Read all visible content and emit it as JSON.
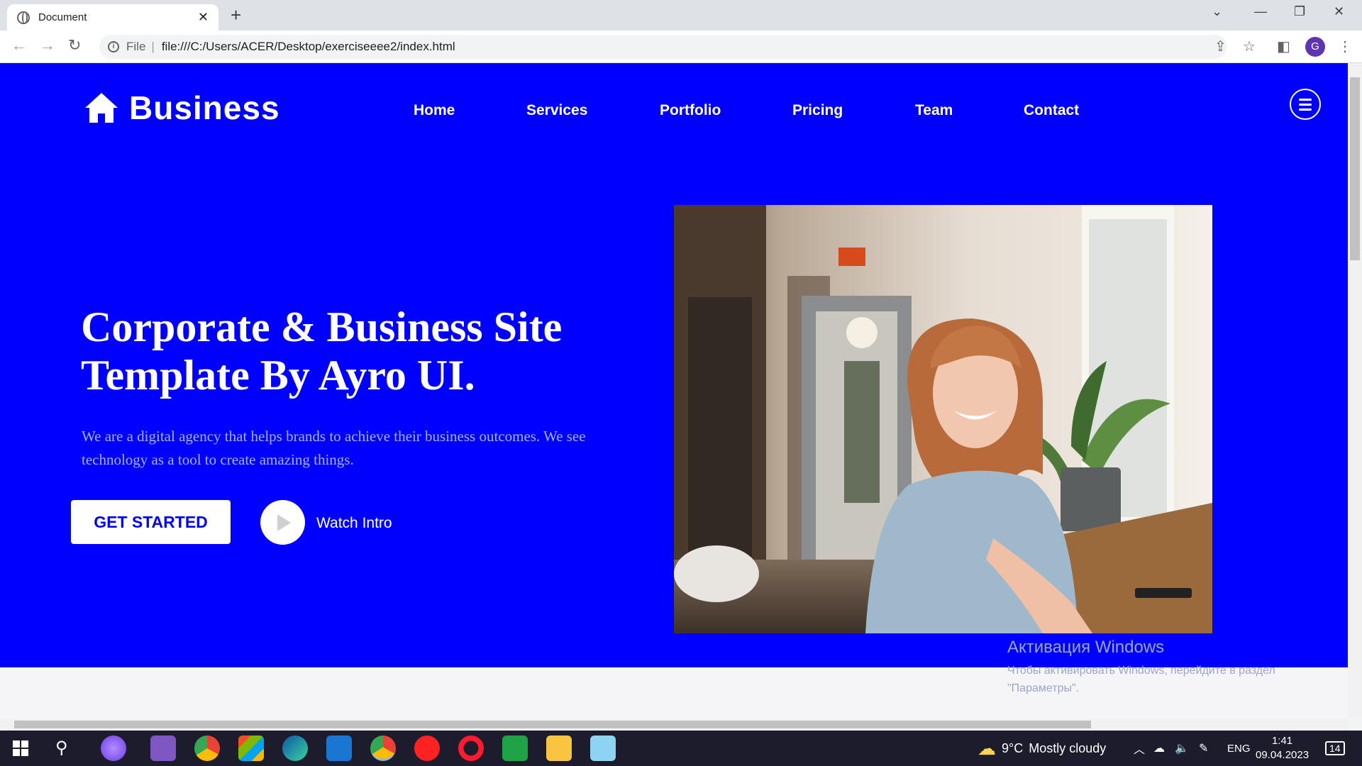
{
  "browser": {
    "tab_title": "Document",
    "tab_close": "✕",
    "new_tab": "+",
    "address_scheme": "File",
    "address_url": "file:///C:/Users/ACER/Desktop/exerciseeee2/index.html",
    "profile_initial": "G"
  },
  "site": {
    "brand": "Business",
    "nav": [
      "Home",
      "Services",
      "Portfolio",
      "Pricing",
      "Team",
      "Contact"
    ],
    "headline": "Corporate & Business Site Template By Ayro UI.",
    "subtext": "We are a digital agency that helps brands to achieve their business outcomes. We see technology as a tool to create amazing things.",
    "cta_primary": "GET STARTED",
    "cta_secondary": "Watch Intro",
    "hero_color": "#0000ff"
  },
  "watermark": {
    "title": "Активация Windows",
    "line1": "Чтобы активировать Windows, перейдите в раздел",
    "line2": "\"Параметры\"."
  },
  "taskbar": {
    "weather_temp": "9°C",
    "weather_desc": "Mostly cloudy",
    "language": "ENG",
    "time": "1:41",
    "date": "09.04.2023",
    "notifications": "14"
  }
}
